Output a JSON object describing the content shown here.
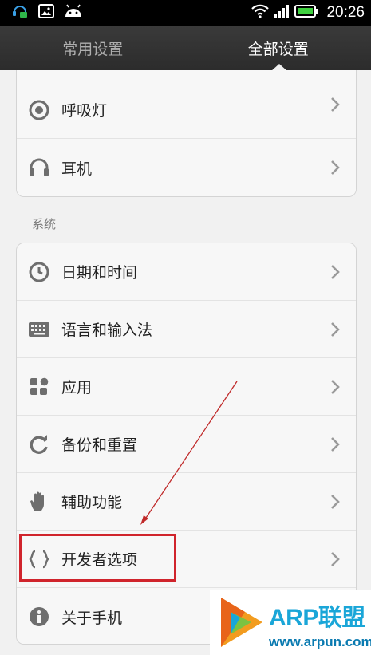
{
  "status_bar": {
    "time": "20:26",
    "icons": [
      "headset-notification-icon",
      "image-notification-icon",
      "android-notification-icon",
      "wifi-icon",
      "signal-icon",
      "battery-icon"
    ]
  },
  "tabs": [
    {
      "label": "常用设置",
      "active": false
    },
    {
      "label": "全部设置",
      "active": true
    }
  ],
  "top_group": {
    "items": [
      {
        "label": "呼吸灯",
        "icon": "breathing-light-icon"
      },
      {
        "label": "耳机",
        "icon": "headphone-icon"
      }
    ]
  },
  "system_section": {
    "title": "系统",
    "items": [
      {
        "label": "日期和时间",
        "icon": "clock-icon"
      },
      {
        "label": "语言和输入法",
        "icon": "keyboard-icon"
      },
      {
        "label": "应用",
        "icon": "apps-icon"
      },
      {
        "label": "备份和重置",
        "icon": "backup-icon"
      },
      {
        "label": "辅助功能",
        "icon": "hand-icon"
      },
      {
        "label": "开发者选项",
        "icon": "braces-icon"
      },
      {
        "label": "关于手机",
        "icon": "info-icon"
      }
    ]
  },
  "annotation": {
    "highlight_color": "#d0242c",
    "highlight_target": "开发者选项"
  },
  "watermark": {
    "title": "ARP联盟",
    "url": "www.arpun.com"
  },
  "colors": {
    "accent_cyan": "#1aa6d8",
    "tabbar_bg": "#2c2c2c",
    "icon_gray": "#7a7a7a"
  }
}
